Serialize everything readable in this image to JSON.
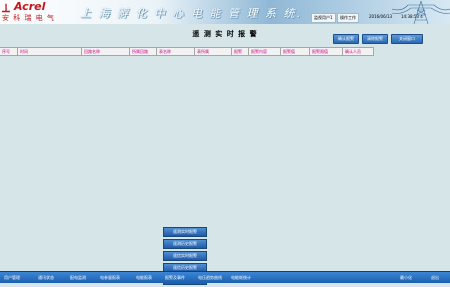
{
  "header": {
    "logo_en": "Acrel",
    "logo_cn": "安 科 瑞 电 气",
    "system_title": "上 海 孵 化 中 心 电 能 管 理 系 统.",
    "user": "监视用户1",
    "location": "操作工作",
    "date": "2016/06/13",
    "time": "14:38:53 4"
  },
  "toolbar": {
    "title": "遥 测 实 时 报 警",
    "buttons": [
      "确认报警",
      "清除报警",
      "关闭窗口"
    ]
  },
  "table": {
    "columns": [
      "序号",
      "时间",
      "回路名称",
      "所属回路",
      "表名称",
      "表所属",
      "报警",
      "报警内容",
      "报警值",
      "报警限值",
      "确认人员"
    ]
  },
  "menu": {
    "items": [
      "遥测实时报警",
      "遥测历史报警",
      "遥信实时报警",
      "遥信历史报警",
      "事件记录"
    ]
  },
  "bottom_nav": {
    "items": [
      "用户管理",
      "通讯状态",
      "配电监测",
      "电参量报表",
      "电能报表",
      "报警及事件",
      "电压趋势曲线",
      "电能耗统计"
    ],
    "minimize": "最小化",
    "exit": "退出"
  },
  "colors": {
    "background": "#d6e6e8",
    "nav_blue": "#1a5fb0",
    "header_text": "#d0008f",
    "brand_red": "#c8151b"
  }
}
